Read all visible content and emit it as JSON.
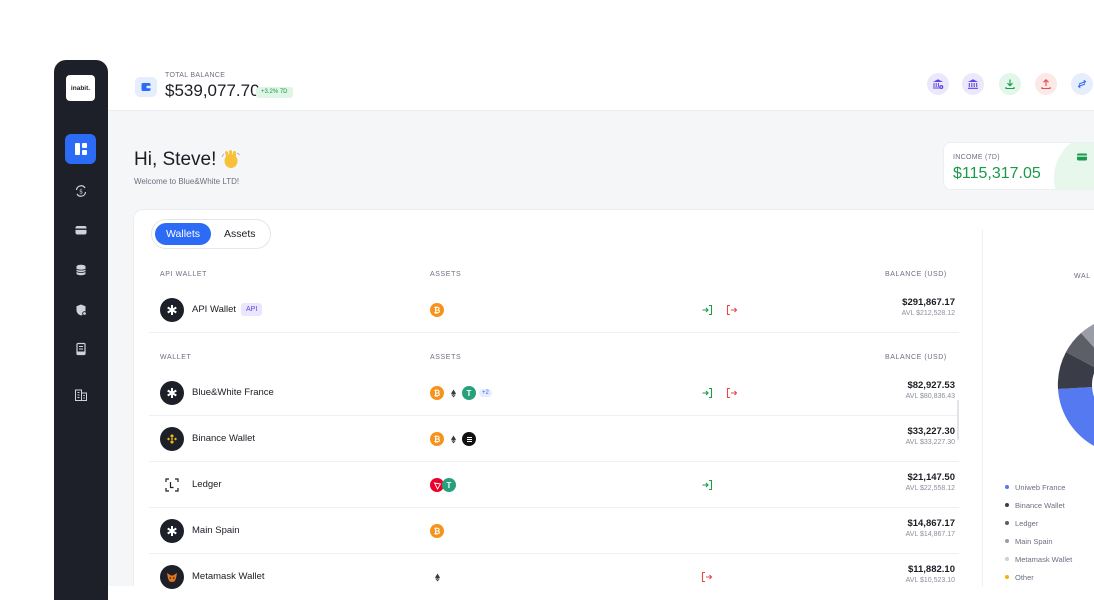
{
  "app": {
    "logo": "inabit."
  },
  "topbar": {
    "label": "TOTAL BALANCE",
    "value": "$539,077.70",
    "change": "+3.2% 7D"
  },
  "greeting": {
    "title": "Hi, Steve!",
    "subtitle": "Welcome to Blue&White LTD!"
  },
  "income": {
    "label": "INCOME (7D)",
    "value": "$115,317.05"
  },
  "tabs": [
    "Wallets",
    "Assets"
  ],
  "api_section": {
    "headers": {
      "name": "API WALLET",
      "assets": "ASSETS",
      "balance": "BALANCE (USD)"
    },
    "rows": [
      {
        "name": "API Wallet",
        "tag": "API",
        "balance": "$291,867.17",
        "available": "AVL $212,528.12"
      }
    ]
  },
  "wallet_section": {
    "headers": {
      "name": "WALLET",
      "assets": "ASSETS",
      "balance": "BALANCE (USD)"
    },
    "rows": [
      {
        "name": "Blue&White France",
        "more": "+2",
        "balance": "$82,927.53",
        "available": "AVL $80,836.43"
      },
      {
        "name": "Binance Wallet",
        "balance": "$33,227.30",
        "available": "AVL $33,227.30"
      },
      {
        "name": "Ledger",
        "balance": "$21,147.50",
        "available": "AVL $22,558.12"
      },
      {
        "name": "Main Spain",
        "balance": "$14,867.17",
        "available": "AVL $14,867.17"
      },
      {
        "name": "Metamask Wallet",
        "balance": "$11,882.10",
        "available": "AVL $10,523.10"
      }
    ]
  },
  "right_panel": {
    "label": "WAL",
    "legend": [
      {
        "name": "Uniweb France",
        "color": "#5479f0"
      },
      {
        "name": "Binance Wallet",
        "color": "#3a3d47"
      },
      {
        "name": "Ledger",
        "color": "#5c5f68"
      },
      {
        "name": "Main Spain",
        "color": "#9a9da5"
      },
      {
        "name": "Metamask Wallet",
        "color": "#cfd1d6"
      },
      {
        "name": "Other",
        "color": "#f5b400"
      }
    ]
  },
  "colors": {
    "accent": "#2c6bf5",
    "sidebar": "#1d2029",
    "positive": "#1a9a4a",
    "negative": "#e5484d"
  }
}
